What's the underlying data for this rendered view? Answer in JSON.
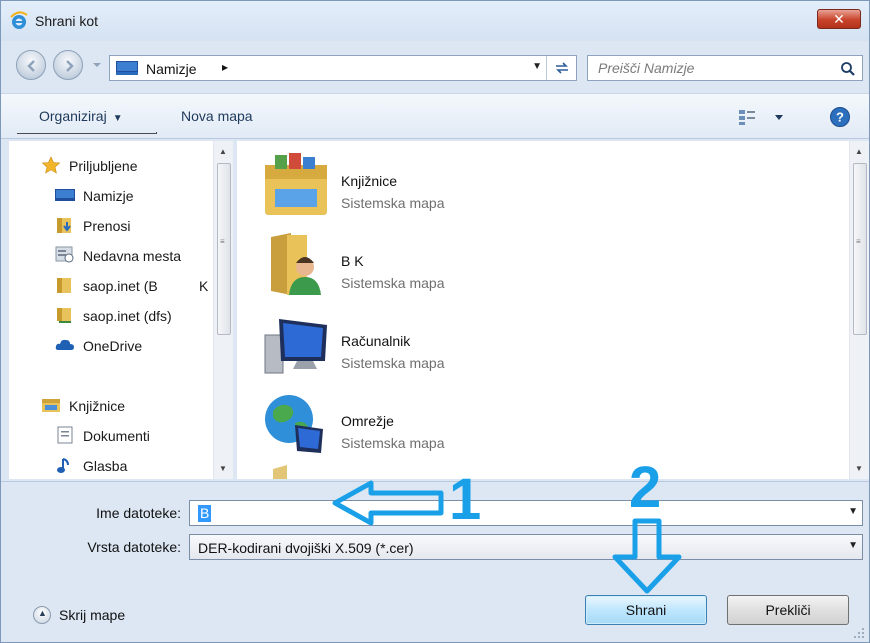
{
  "window": {
    "title": "Shrani kot",
    "close_label": "✕"
  },
  "address": {
    "location": "Namizje",
    "separator": "▸",
    "search_placeholder": "Preišči Namizje"
  },
  "toolbar": {
    "organize": "Organiziraj",
    "new_folder": "Nova mapa"
  },
  "nav": {
    "favorites": [
      {
        "label": "Priljubljene",
        "icon": "star-icon"
      },
      {
        "label": "Namizje",
        "icon": "desktop-icon"
      },
      {
        "label": "Prenosi",
        "icon": "downloads-icon"
      },
      {
        "label": "Nedavna mesta",
        "icon": "recent-places-icon"
      },
      {
        "label": "saop.inet (B",
        "suffix": "K",
        "icon": "folder-icon"
      },
      {
        "label": "saop.inet (dfs)",
        "icon": "folder-icon"
      },
      {
        "label": "OneDrive",
        "icon": "cloud-icon"
      }
    ],
    "libraries": [
      {
        "label": "Knjižnice",
        "icon": "libraries-icon"
      },
      {
        "label": "Dokumenti",
        "icon": "document-icon"
      },
      {
        "label": "Glasba",
        "icon": "music-icon"
      }
    ]
  },
  "content": {
    "items": [
      {
        "name": "Knjižnice",
        "type": "Sistemska mapa"
      },
      {
        "name": "B      K",
        "type": "Sistemska mapa"
      },
      {
        "name": "Računalnik",
        "type": "Sistemska mapa"
      },
      {
        "name": "Omrežje",
        "type": "Sistemska mapa"
      }
    ]
  },
  "form": {
    "filename_label": "Ime datoteke:",
    "filename_value": "B",
    "filetype_label": "Vrsta datoteke:",
    "filetype_value": "DER-kodirani dvojiški X.509 (*.cer)"
  },
  "footer": {
    "hide_folders": "Skrij mape",
    "save": "Shrani",
    "cancel": "Prekliči"
  },
  "annotations": {
    "step1": "1",
    "step2": "2"
  },
  "colors": {
    "annotation": "#1aa0e8",
    "save_button": "#bee6fd",
    "frame": "#dce7f3"
  }
}
